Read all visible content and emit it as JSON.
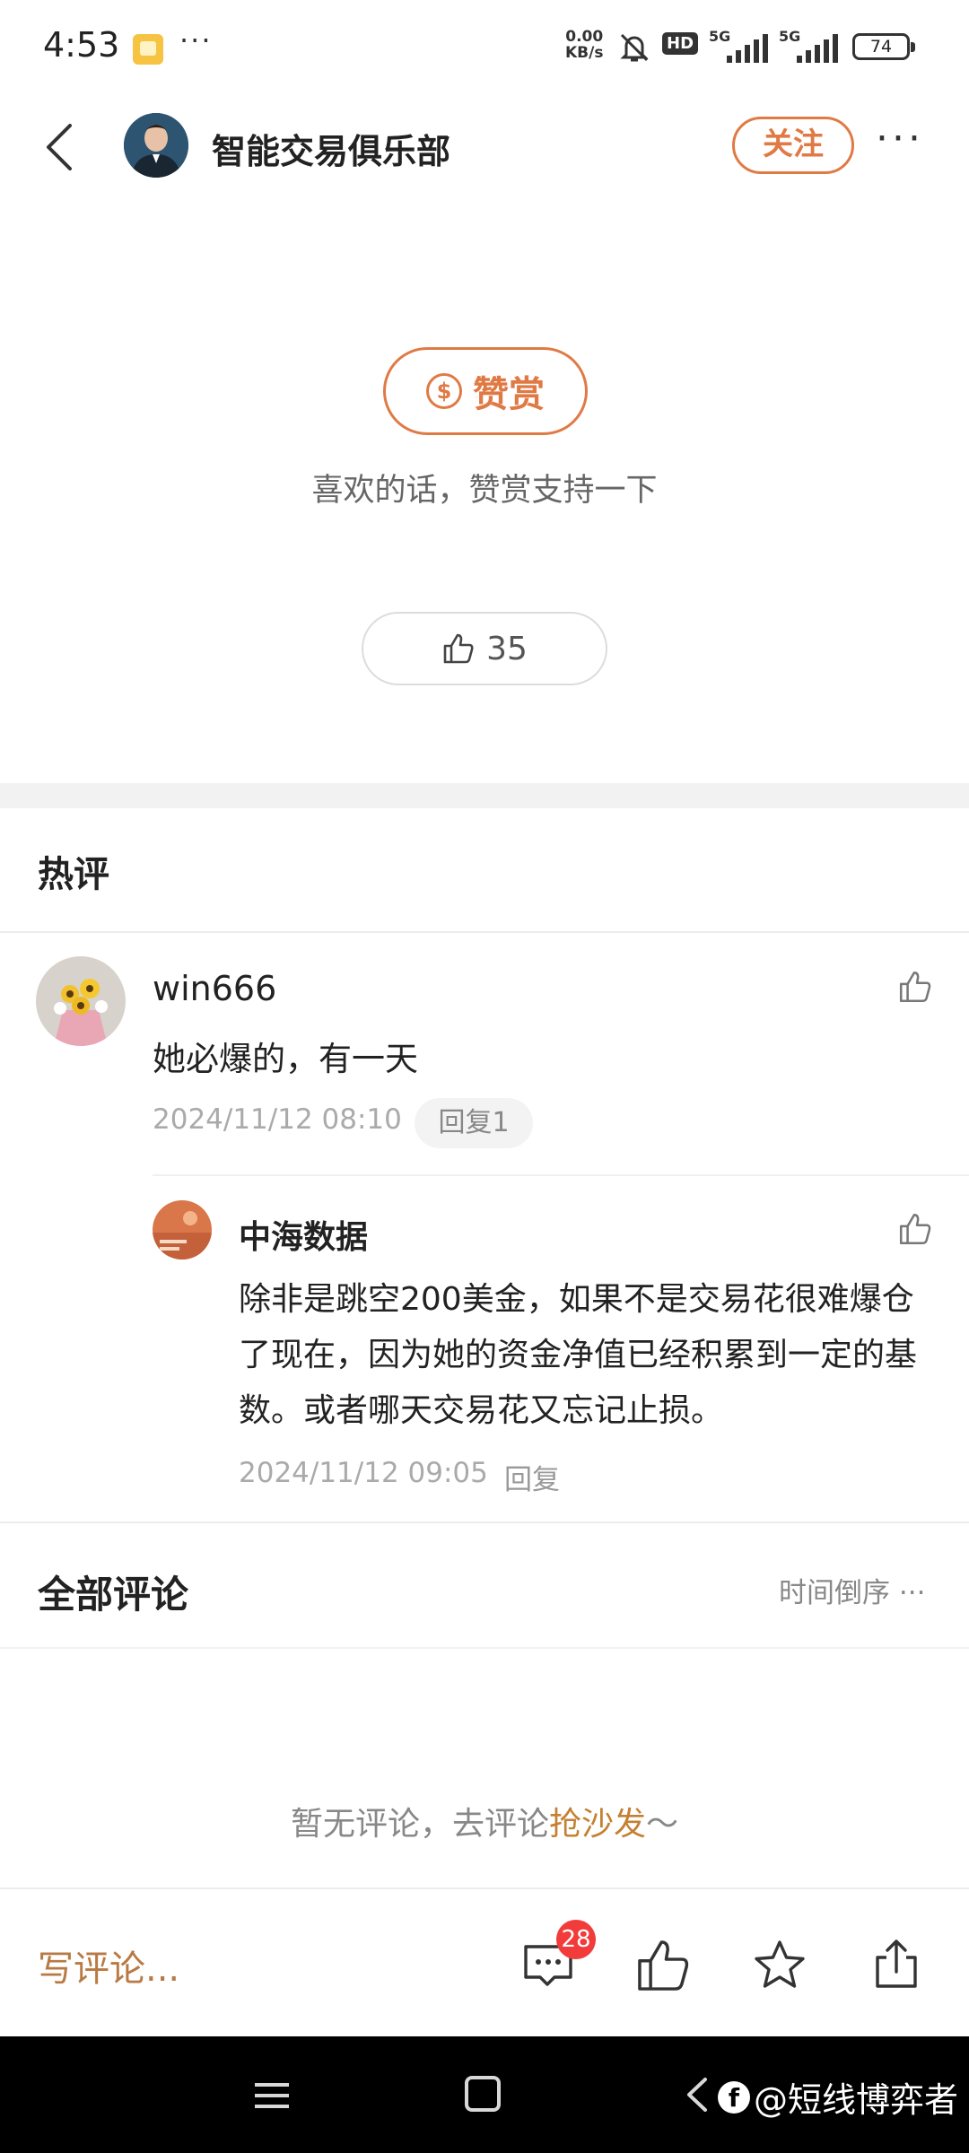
{
  "status_bar": {
    "time": "4:53",
    "dots": "···",
    "net_speed_value": "0.00",
    "net_speed_unit": "KB/s",
    "hd": "HD",
    "signal1": "5G",
    "signal2": "5G",
    "battery": "74"
  },
  "header": {
    "account_name": "智能交易俱乐部",
    "follow_label": "关注",
    "more_label": "···"
  },
  "tip": {
    "button_label": "赞赏",
    "coin_symbol": "$",
    "caption": "喜欢的话，赞赏支持一下"
  },
  "likes": {
    "count": "35"
  },
  "hot_comments": {
    "title": "热评",
    "items": [
      {
        "user": "win666",
        "text": "她必爆的，有一天",
        "time": "2024/11/12 08:10",
        "reply_label": "回复1",
        "replies": [
          {
            "user": "中海数据",
            "text": "除非是跳空200美金，如果不是交易花很难爆仓了现在，因为她的资金净值已经积累到一定的基数。或者哪天交易花又忘记止损。",
            "time": "2024/11/12 09:05",
            "reply_label": "回复"
          }
        ]
      }
    ]
  },
  "all_comments": {
    "title": "全部评论",
    "sort_label": "时间倒序",
    "empty_prefix": "暂无评论，去评论",
    "empty_link": "抢沙发",
    "empty_suffix": "～"
  },
  "bottom_bar": {
    "write_placeholder": "写评论...",
    "comment_count": "28"
  },
  "watermark": {
    "logo": "f",
    "text": "@短线博弈者"
  },
  "colors": {
    "accent": "#e07a45",
    "link": "#c48033",
    "badge": "#f23b3b"
  }
}
